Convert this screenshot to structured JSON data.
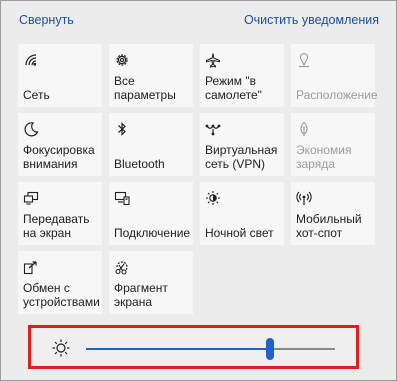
{
  "header": {
    "collapse_label": "Свернуть",
    "clear_label": "Очистить уведомления"
  },
  "tiles": [
    {
      "label": "Сеть",
      "icon": "network-icon",
      "dim": false
    },
    {
      "label": "Все параметры",
      "icon": "gear-icon",
      "dim": false
    },
    {
      "label": "Режим \"в самолете\"",
      "icon": "airplane-icon",
      "dim": false
    },
    {
      "label": "Расположение",
      "icon": "location-icon",
      "dim": true
    },
    {
      "label": "Фокусировка внимания",
      "icon": "moon-icon",
      "dim": false
    },
    {
      "label": "Bluetooth",
      "icon": "bluetooth-icon",
      "dim": false
    },
    {
      "label": "Виртуальная сеть (VPN)",
      "icon": "vpn-icon",
      "dim": false
    },
    {
      "label": "Экономия заряда",
      "icon": "battery-saver-icon",
      "dim": true
    },
    {
      "label": "Передавать на экран",
      "icon": "project-icon",
      "dim": false
    },
    {
      "label": "Подключение",
      "icon": "connect-icon",
      "dim": false
    },
    {
      "label": "Ночной свет",
      "icon": "night-light-icon",
      "dim": false
    },
    {
      "label": "Мобильный хот-спот",
      "icon": "hotspot-icon",
      "dim": false
    },
    {
      "label": "Обмен с устройствами",
      "icon": "nearby-share-icon",
      "dim": false
    },
    {
      "label": "Фрагмент экрана",
      "icon": "snip-icon",
      "dim": false
    }
  ],
  "brightness": {
    "icon": "brightness-icon",
    "value": 0.74,
    "accent": "#1f61c4",
    "highlight": "#e02020"
  }
}
